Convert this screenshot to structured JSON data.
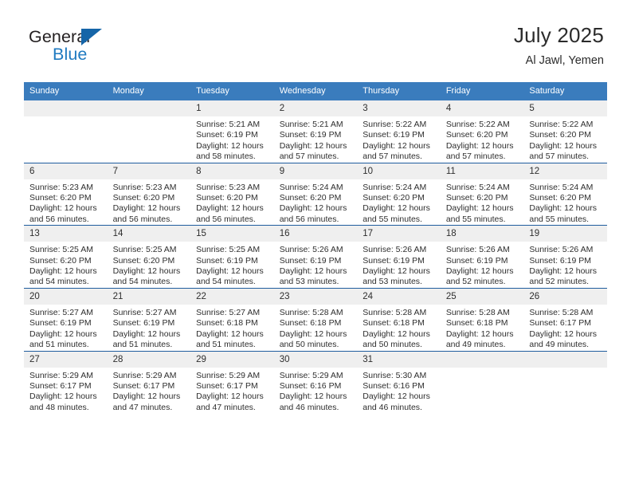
{
  "brand": {
    "word_one": "General",
    "word_two": "Blue",
    "triangle_icon": "brand-triangle-icon"
  },
  "header": {
    "title": "July 2025",
    "location": "Al Jawl, Yemen"
  },
  "calendar": {
    "day_headers": [
      "Sunday",
      "Monday",
      "Tuesday",
      "Wednesday",
      "Thursday",
      "Friday",
      "Saturday"
    ],
    "header_bg": "#3a7cbd",
    "row_divider": "#1f5c9e",
    "daynum_band_bg": "#efefef",
    "weeks": [
      [
        {
          "day": "",
          "sunrise": "",
          "sunset": "",
          "daylight_line1": "",
          "daylight_line2": "",
          "empty": true
        },
        {
          "day": "",
          "sunrise": "",
          "sunset": "",
          "daylight_line1": "",
          "daylight_line2": "",
          "empty": true
        },
        {
          "day": "1",
          "sunrise": "Sunrise: 5:21 AM",
          "sunset": "Sunset: 6:19 PM",
          "daylight_line1": "Daylight: 12 hours",
          "daylight_line2": "and 58 minutes."
        },
        {
          "day": "2",
          "sunrise": "Sunrise: 5:21 AM",
          "sunset": "Sunset: 6:19 PM",
          "daylight_line1": "Daylight: 12 hours",
          "daylight_line2": "and 57 minutes."
        },
        {
          "day": "3",
          "sunrise": "Sunrise: 5:22 AM",
          "sunset": "Sunset: 6:19 PM",
          "daylight_line1": "Daylight: 12 hours",
          "daylight_line2": "and 57 minutes."
        },
        {
          "day": "4",
          "sunrise": "Sunrise: 5:22 AM",
          "sunset": "Sunset: 6:20 PM",
          "daylight_line1": "Daylight: 12 hours",
          "daylight_line2": "and 57 minutes."
        },
        {
          "day": "5",
          "sunrise": "Sunrise: 5:22 AM",
          "sunset": "Sunset: 6:20 PM",
          "daylight_line1": "Daylight: 12 hours",
          "daylight_line2": "and 57 minutes."
        }
      ],
      [
        {
          "day": "6",
          "sunrise": "Sunrise: 5:23 AM",
          "sunset": "Sunset: 6:20 PM",
          "daylight_line1": "Daylight: 12 hours",
          "daylight_line2": "and 56 minutes."
        },
        {
          "day": "7",
          "sunrise": "Sunrise: 5:23 AM",
          "sunset": "Sunset: 6:20 PM",
          "daylight_line1": "Daylight: 12 hours",
          "daylight_line2": "and 56 minutes."
        },
        {
          "day": "8",
          "sunrise": "Sunrise: 5:23 AM",
          "sunset": "Sunset: 6:20 PM",
          "daylight_line1": "Daylight: 12 hours",
          "daylight_line2": "and 56 minutes."
        },
        {
          "day": "9",
          "sunrise": "Sunrise: 5:24 AM",
          "sunset": "Sunset: 6:20 PM",
          "daylight_line1": "Daylight: 12 hours",
          "daylight_line2": "and 56 minutes."
        },
        {
          "day": "10",
          "sunrise": "Sunrise: 5:24 AM",
          "sunset": "Sunset: 6:20 PM",
          "daylight_line1": "Daylight: 12 hours",
          "daylight_line2": "and 55 minutes."
        },
        {
          "day": "11",
          "sunrise": "Sunrise: 5:24 AM",
          "sunset": "Sunset: 6:20 PM",
          "daylight_line1": "Daylight: 12 hours",
          "daylight_line2": "and 55 minutes."
        },
        {
          "day": "12",
          "sunrise": "Sunrise: 5:24 AM",
          "sunset": "Sunset: 6:20 PM",
          "daylight_line1": "Daylight: 12 hours",
          "daylight_line2": "and 55 minutes."
        }
      ],
      [
        {
          "day": "13",
          "sunrise": "Sunrise: 5:25 AM",
          "sunset": "Sunset: 6:20 PM",
          "daylight_line1": "Daylight: 12 hours",
          "daylight_line2": "and 54 minutes."
        },
        {
          "day": "14",
          "sunrise": "Sunrise: 5:25 AM",
          "sunset": "Sunset: 6:20 PM",
          "daylight_line1": "Daylight: 12 hours",
          "daylight_line2": "and 54 minutes."
        },
        {
          "day": "15",
          "sunrise": "Sunrise: 5:25 AM",
          "sunset": "Sunset: 6:19 PM",
          "daylight_line1": "Daylight: 12 hours",
          "daylight_line2": "and 54 minutes."
        },
        {
          "day": "16",
          "sunrise": "Sunrise: 5:26 AM",
          "sunset": "Sunset: 6:19 PM",
          "daylight_line1": "Daylight: 12 hours",
          "daylight_line2": "and 53 minutes."
        },
        {
          "day": "17",
          "sunrise": "Sunrise: 5:26 AM",
          "sunset": "Sunset: 6:19 PM",
          "daylight_line1": "Daylight: 12 hours",
          "daylight_line2": "and 53 minutes."
        },
        {
          "day": "18",
          "sunrise": "Sunrise: 5:26 AM",
          "sunset": "Sunset: 6:19 PM",
          "daylight_line1": "Daylight: 12 hours",
          "daylight_line2": "and 52 minutes."
        },
        {
          "day": "19",
          "sunrise": "Sunrise: 5:26 AM",
          "sunset": "Sunset: 6:19 PM",
          "daylight_line1": "Daylight: 12 hours",
          "daylight_line2": "and 52 minutes."
        }
      ],
      [
        {
          "day": "20",
          "sunrise": "Sunrise: 5:27 AM",
          "sunset": "Sunset: 6:19 PM",
          "daylight_line1": "Daylight: 12 hours",
          "daylight_line2": "and 51 minutes."
        },
        {
          "day": "21",
          "sunrise": "Sunrise: 5:27 AM",
          "sunset": "Sunset: 6:19 PM",
          "daylight_line1": "Daylight: 12 hours",
          "daylight_line2": "and 51 minutes."
        },
        {
          "day": "22",
          "sunrise": "Sunrise: 5:27 AM",
          "sunset": "Sunset: 6:18 PM",
          "daylight_line1": "Daylight: 12 hours",
          "daylight_line2": "and 51 minutes."
        },
        {
          "day": "23",
          "sunrise": "Sunrise: 5:28 AM",
          "sunset": "Sunset: 6:18 PM",
          "daylight_line1": "Daylight: 12 hours",
          "daylight_line2": "and 50 minutes."
        },
        {
          "day": "24",
          "sunrise": "Sunrise: 5:28 AM",
          "sunset": "Sunset: 6:18 PM",
          "daylight_line1": "Daylight: 12 hours",
          "daylight_line2": "and 50 minutes."
        },
        {
          "day": "25",
          "sunrise": "Sunrise: 5:28 AM",
          "sunset": "Sunset: 6:18 PM",
          "daylight_line1": "Daylight: 12 hours",
          "daylight_line2": "and 49 minutes."
        },
        {
          "day": "26",
          "sunrise": "Sunrise: 5:28 AM",
          "sunset": "Sunset: 6:17 PM",
          "daylight_line1": "Daylight: 12 hours",
          "daylight_line2": "and 49 minutes."
        }
      ],
      [
        {
          "day": "27",
          "sunrise": "Sunrise: 5:29 AM",
          "sunset": "Sunset: 6:17 PM",
          "daylight_line1": "Daylight: 12 hours",
          "daylight_line2": "and 48 minutes."
        },
        {
          "day": "28",
          "sunrise": "Sunrise: 5:29 AM",
          "sunset": "Sunset: 6:17 PM",
          "daylight_line1": "Daylight: 12 hours",
          "daylight_line2": "and 47 minutes."
        },
        {
          "day": "29",
          "sunrise": "Sunrise: 5:29 AM",
          "sunset": "Sunset: 6:17 PM",
          "daylight_line1": "Daylight: 12 hours",
          "daylight_line2": "and 47 minutes."
        },
        {
          "day": "30",
          "sunrise": "Sunrise: 5:29 AM",
          "sunset": "Sunset: 6:16 PM",
          "daylight_line1": "Daylight: 12 hours",
          "daylight_line2": "and 46 minutes."
        },
        {
          "day": "31",
          "sunrise": "Sunrise: 5:30 AM",
          "sunset": "Sunset: 6:16 PM",
          "daylight_line1": "Daylight: 12 hours",
          "daylight_line2": "and 46 minutes."
        },
        {
          "day": "",
          "sunrise": "",
          "sunset": "",
          "daylight_line1": "",
          "daylight_line2": "",
          "empty": true
        },
        {
          "day": "",
          "sunrise": "",
          "sunset": "",
          "daylight_line1": "",
          "daylight_line2": "",
          "empty": true
        }
      ]
    ]
  }
}
